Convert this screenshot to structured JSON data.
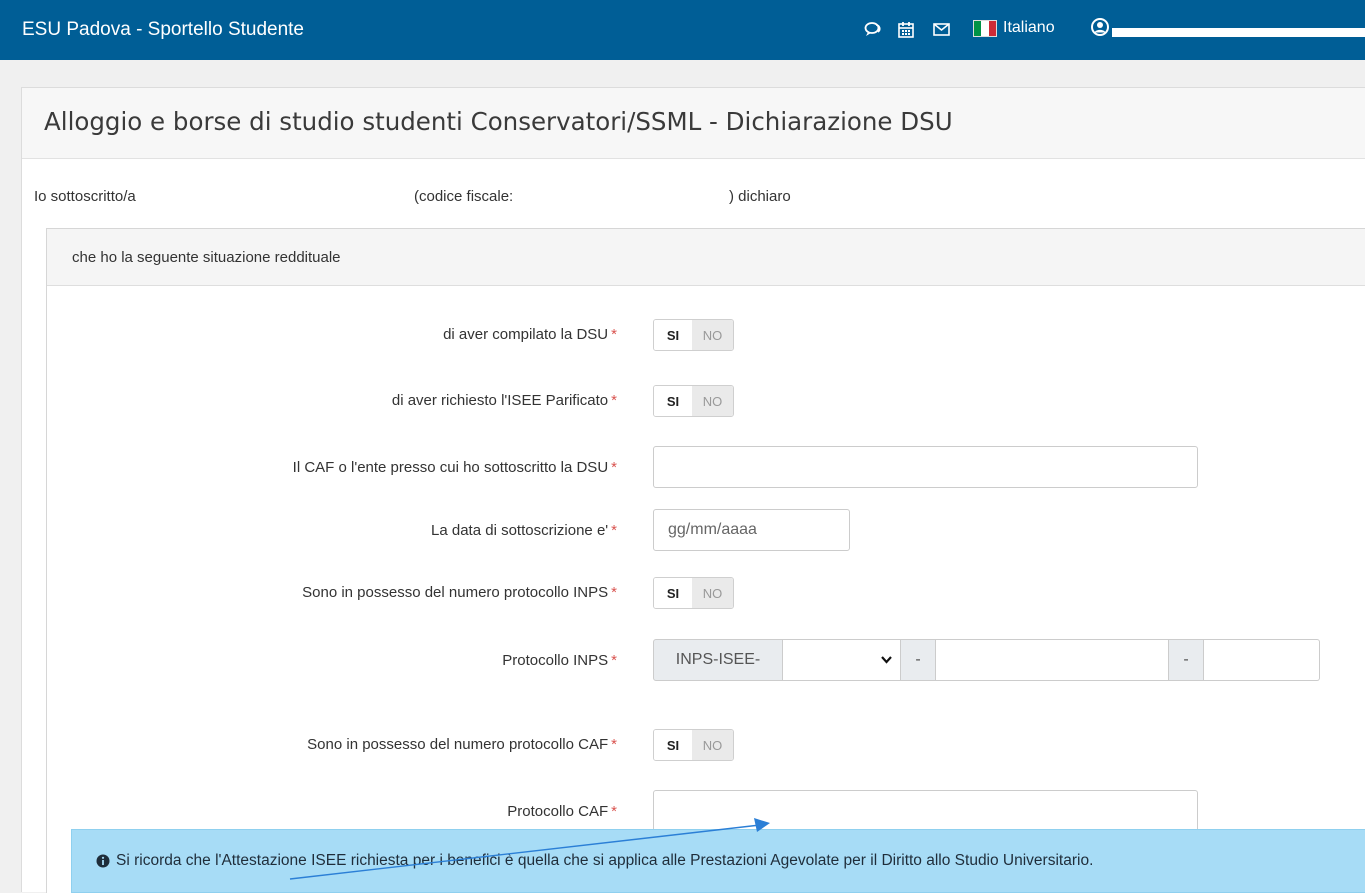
{
  "topbar": {
    "brand": "ESU Padova - Sportello Studente",
    "language": "Italiano",
    "flag_colors": [
      "#009246",
      "#ffffff",
      "#ce2b37"
    ],
    "icons": [
      "comments-icon",
      "calendar-icon",
      "envelope-icon",
      "user-icon"
    ]
  },
  "page": {
    "title": "Alloggio e borse di studio studenti Conservatori/SSML - Dichiarazione DSU"
  },
  "declaration": {
    "part1": "Io sottoscritto/a",
    "part2": "(codice fiscale:",
    "part3": ") dichiaro"
  },
  "section": {
    "title": "che ho la seguente situazione reddituale"
  },
  "toggle_labels": {
    "yes": "SI",
    "no": "NO"
  },
  "form": {
    "dsu_compilata": "di aver compilato la DSU",
    "isee_parificato": "di aver richiesto l'ISEE Parificato",
    "caf_ente": "Il CAF o l'ente presso cui ho sottoscritto la DSU",
    "caf_ente_value": "",
    "data_sottoscrizione": "La data di sottoscrizione e'",
    "data_placeholder": "gg/mm/aaaa",
    "protocollo_inps_possesso": "Sono in possesso del numero protocollo INPS",
    "protocollo_inps": "Protocollo INPS",
    "inps_prefix": "INPS-ISEE-",
    "separator": "-",
    "protocollo_caf_possesso": "Sono in possesso del numero protocollo CAF",
    "protocollo_caf": "Protocollo CAF",
    "protocollo_caf_value": ""
  },
  "required_mark": "*",
  "alert": {
    "text": "Si ricorda che l'Attestazione ISEE richiesta per i benefici è quella che si applica alle Prestazioni Agevolate per il Diritto allo Studio Universitario."
  },
  "colors": {
    "nav": "#005e96",
    "required": "#d9534f",
    "info_bg": "#a7dcf6",
    "annotation_arrow": "#2b7fd6"
  }
}
